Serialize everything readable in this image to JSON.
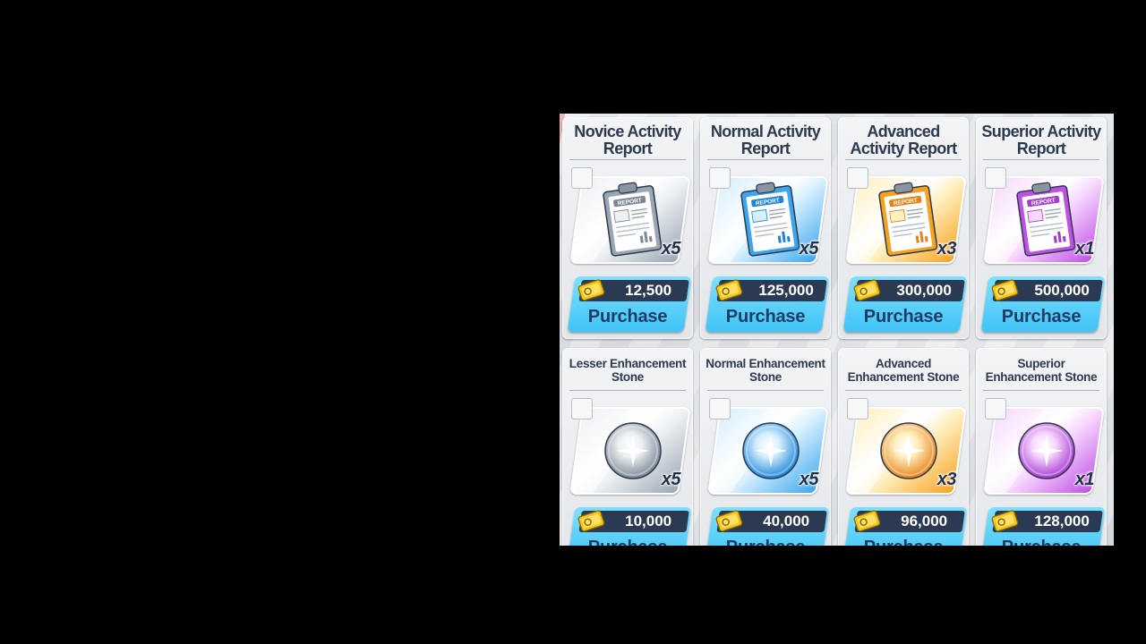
{
  "shop": {
    "items": [
      {
        "title": "Novice Activity Report",
        "qty": "x5",
        "price": "12,500",
        "tier": "gray",
        "kind": "report",
        "purchase_label": "Purchase"
      },
      {
        "title": "Normal Activity Report",
        "qty": "x5",
        "price": "125,000",
        "tier": "blue",
        "kind": "report",
        "purchase_label": "Purchase"
      },
      {
        "title": "Advanced Activity Report",
        "qty": "x3",
        "price": "300,000",
        "tier": "gold",
        "kind": "report",
        "purchase_label": "Purchase"
      },
      {
        "title": "Superior Activity Report",
        "qty": "x1",
        "price": "500,000",
        "tier": "purple",
        "kind": "report",
        "purchase_label": "Purchase"
      },
      {
        "title": "Lesser Enhancement Stone",
        "qty": "x5",
        "price": "10,000",
        "tier": "gray",
        "kind": "stone",
        "purchase_label": "Purchase"
      },
      {
        "title": "Normal Enhancement Stone",
        "qty": "x5",
        "price": "40,000",
        "tier": "blue",
        "kind": "stone",
        "purchase_label": "Purchase"
      },
      {
        "title": "Advanced Enhancement Stone",
        "qty": "x3",
        "price": "96,000",
        "tier": "gold",
        "kind": "stone",
        "purchase_label": "Purchase"
      },
      {
        "title": "Superior Enhancement Stone",
        "qty": "x1",
        "price": "128,000",
        "tier": "purple",
        "kind": "stone",
        "purchase_label": "Purchase"
      }
    ],
    "tier_colors": {
      "gray": {
        "light": "#eef1f4",
        "dark": "#9aa6b2",
        "accent": "#7d8896"
      },
      "blue": {
        "light": "#d6efff",
        "dark": "#3aa6ee",
        "accent": "#1d86d8"
      },
      "gold": {
        "light": "#fff0c2",
        "dark": "#f7a21e",
        "accent": "#e8831a"
      },
      "purple": {
        "light": "#f8d8ff",
        "dark": "#c04fe6",
        "accent": "#a63ad1"
      }
    },
    "currency_icon": "gold-credit-ticket-icon",
    "report_icon": "clipboard-report-icon",
    "stone_icon": "enhancement-orb-icon"
  }
}
